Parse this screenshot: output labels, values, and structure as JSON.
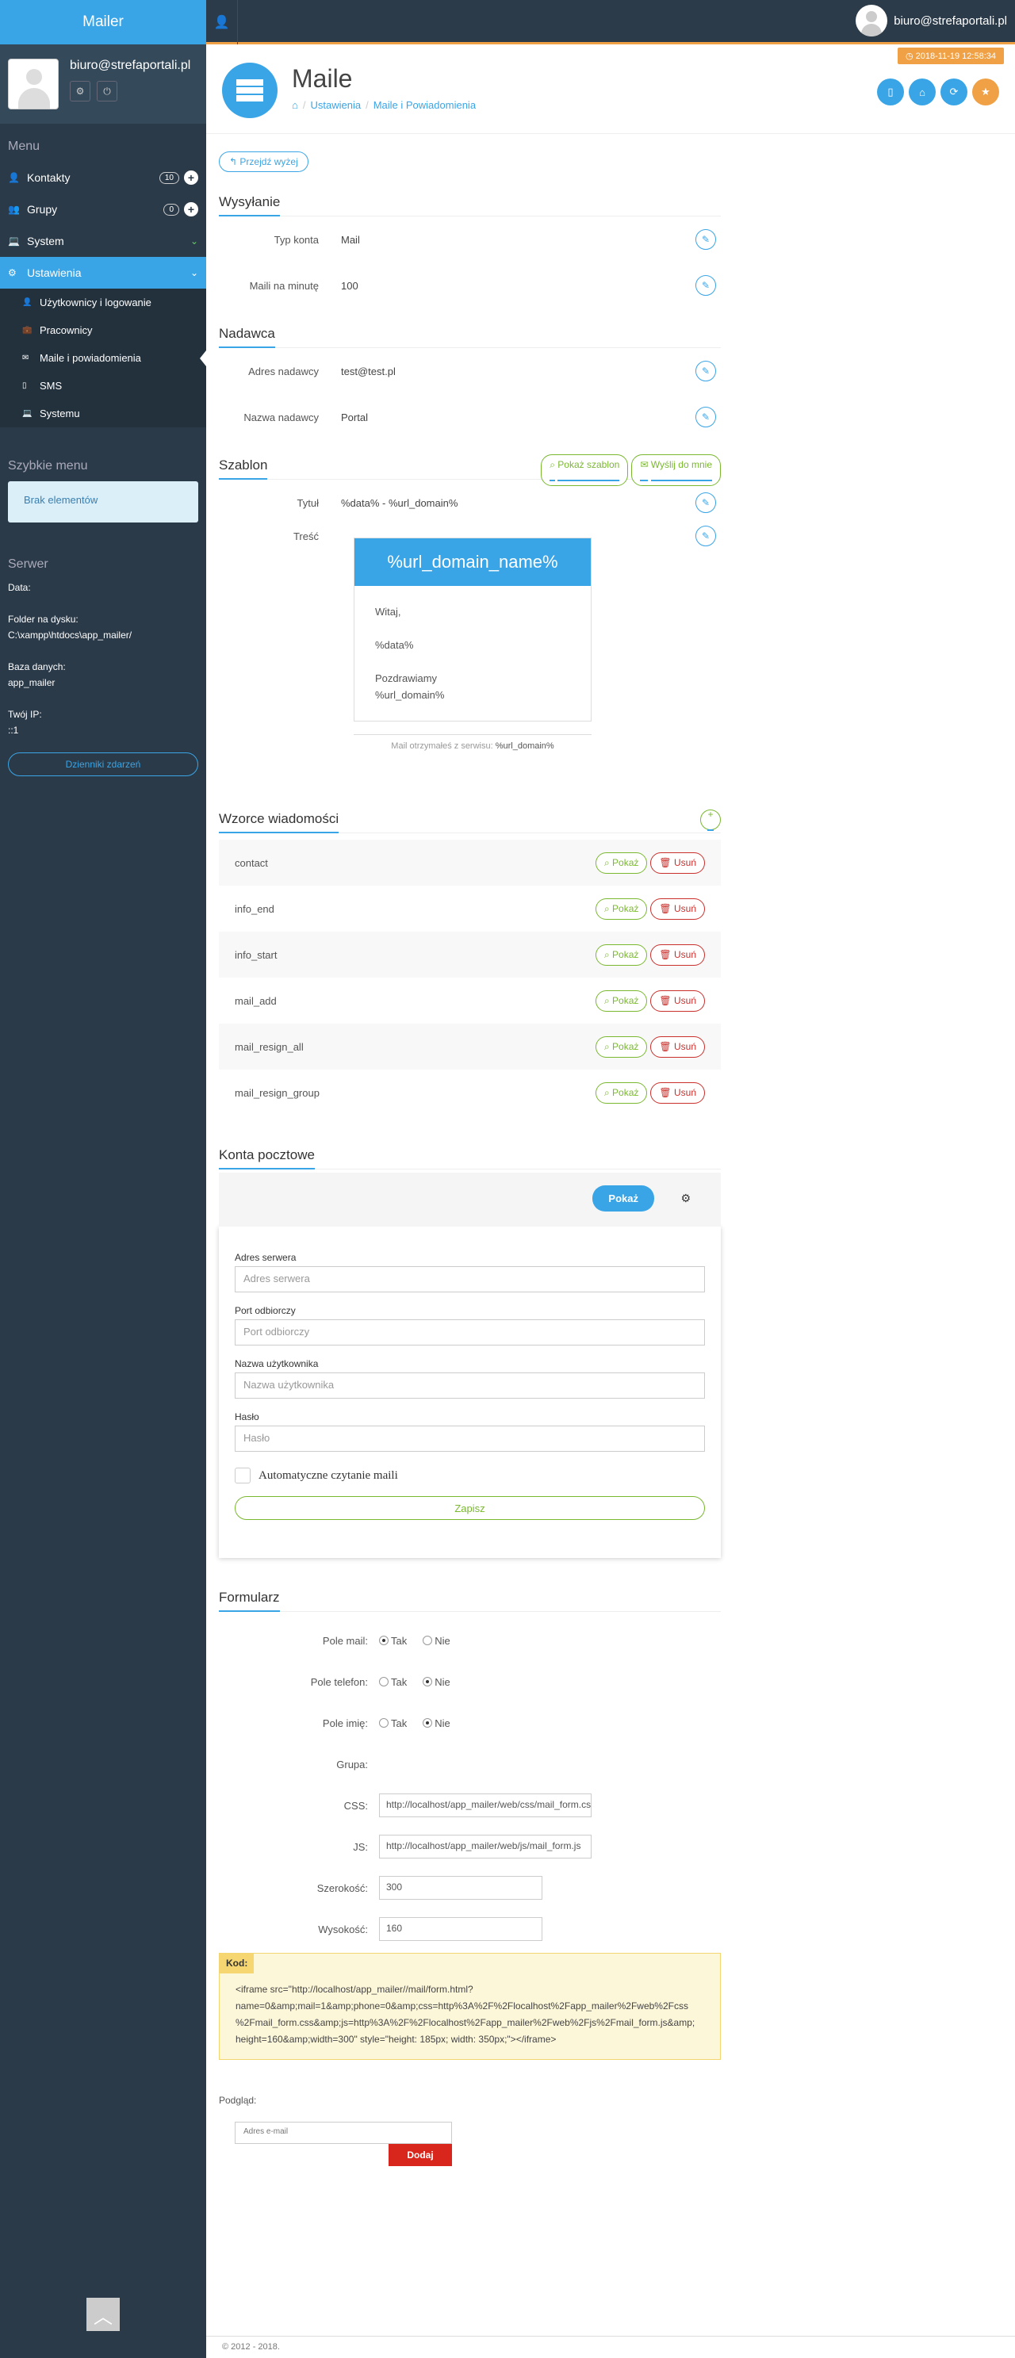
{
  "app": {
    "brand": "Mailer",
    "user_email": "biuro@strefaportali.pl",
    "datetime": "2018-11-19 12:58:34"
  },
  "sidebar": {
    "menu_heading": "Menu",
    "items": [
      {
        "label": "Kontakty",
        "count": "10",
        "icon": "user-icon"
      },
      {
        "label": "Grupy",
        "count": "0",
        "icon": "users-icon"
      },
      {
        "label": "System",
        "icon": "laptop-icon"
      },
      {
        "label": "Ustawienia",
        "icon": "cogs-icon"
      }
    ],
    "sub_items": [
      "Użytkownicy i logowanie",
      "Pracownicy",
      "Maile i powiadomienia",
      "SMS",
      "Systemu"
    ],
    "quick_heading": "Szybkie menu",
    "quick_empty": "Brak elementów",
    "server_heading": "Serwer",
    "server": {
      "data_label": "Data:",
      "folder_label": "Folder na dysku:",
      "folder_value": "C:\\xampp\\htdocs\\app_mailer/",
      "db_label": "Baza danych:",
      "db_value": "app_mailer",
      "ip_label": "Twój IP:",
      "ip_value": "::1"
    },
    "logs_button": "Dzienniki zdarzeń"
  },
  "header": {
    "title": "Maile",
    "breadcrumb": [
      "Ustawienia",
      "Maile i Powiadomienia"
    ]
  },
  "back_button": "Przejdź wyżej",
  "sending": {
    "title": "Wysyłanie",
    "rows": [
      {
        "label": "Typ konta",
        "value": "Mail"
      },
      {
        "label": "Maili na minutę",
        "value": "100"
      }
    ]
  },
  "sender": {
    "title": "Nadawca",
    "rows": [
      {
        "label": "Adres nadawcy",
        "value": "test@test.pl"
      },
      {
        "label": "Nazwa nadawcy",
        "value": "Portal"
      }
    ]
  },
  "template": {
    "title": "Szablon",
    "show_button": "Pokaż szablon",
    "send_button": "Wyślij do mnie",
    "subject_label": "Tytuł",
    "subject_value": "%data% - %url_domain%",
    "content_label": "Treść",
    "header": "%url_domain_name%",
    "body_l1": "Witaj,",
    "body_l2": "%data%",
    "body_l3": "Pozdrawiamy",
    "body_l4": "%url_domain%",
    "footer_text": "Mail otrzymałeś z serwisu:",
    "footer_domain": "%url_domain%"
  },
  "patterns": {
    "title": "Wzorce wiadomości",
    "show_label": "Pokaż",
    "delete_label": "Usuń",
    "items": [
      "contact",
      "info_end",
      "info_start",
      "mail_add",
      "mail_resign_all",
      "mail_resign_group"
    ]
  },
  "mail_accounts": {
    "title": "Konta pocztowe",
    "show_button": "Pokaż",
    "fields": [
      {
        "label": "Adres serwera",
        "placeholder": "Adres serwera"
      },
      {
        "label": "Port odbiorczy",
        "placeholder": "Port odbiorczy"
      },
      {
        "label": "Nazwa użytkownika",
        "placeholder": "Nazwa użytkownika"
      },
      {
        "label": "Hasło",
        "placeholder": "Hasło"
      }
    ],
    "auto_read_label": "Automatyczne czytanie maili",
    "save_button": "Zapisz"
  },
  "form": {
    "title": "Formularz",
    "yes": "Tak",
    "no": "Nie",
    "mail_label": "Pole mail:",
    "phone_label": "Pole telefon:",
    "name_label": "Pole imię:",
    "group_label": "Grupa:",
    "css_label": "CSS:",
    "css_value": "http://localhost/app_mailer/web/css/mail_form.css",
    "js_label": "JS:",
    "js_value": "http://localhost/app_mailer/web/js/mail_form.js",
    "width_label": "Szerokość:",
    "width_value": "300",
    "height_label": "Wysokość:",
    "height_value": "160",
    "code_label": "Kod:",
    "code_l1": "<iframe src=\"http://localhost/app_mailer//mail/form.html?",
    "code_l2": "name=0&amp;mail=1&amp;phone=0&amp;css=http%3A%2F%2Flocalhost%2Fapp_mailer%2Fweb%2Fcss",
    "code_l3": "%2Fmail_form.css&amp;js=http%3A%2F%2Flocalhost%2Fapp_mailer%2Fweb%2Fjs%2Fmail_form.js&amp;",
    "code_l4": "height=160&amp;width=300\" style=\"height: 185px; width: 350px;\"></iframe>",
    "preview_label": "Podgląd:",
    "preview_placeholder": "Adres e-mail",
    "preview_button": "Dodaj"
  },
  "footer": {
    "copyright": "© 2012 - 2018."
  }
}
